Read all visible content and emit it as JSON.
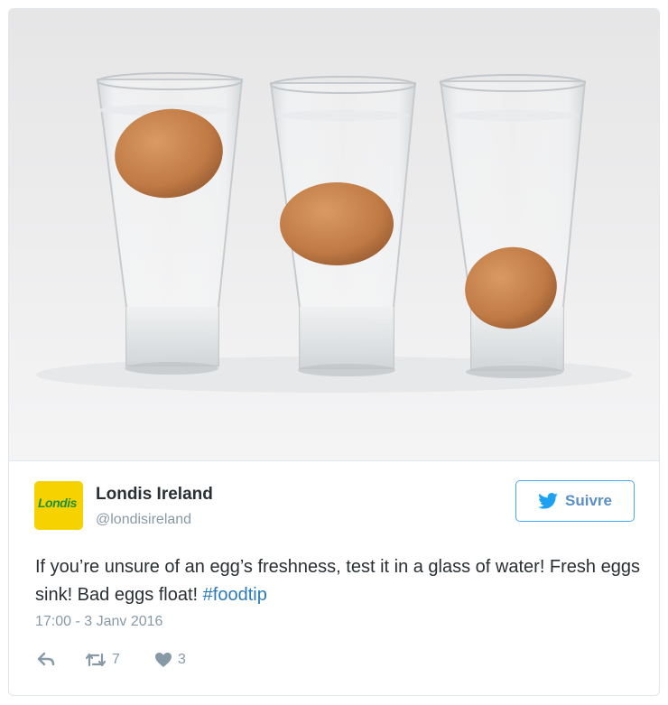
{
  "tweet": {
    "author_name": "Londis Ireland",
    "author_handle": "@londisireland",
    "avatar_text": "Londis",
    "follow_label": "Suivre",
    "text_main": "If you’re unsure of an egg’s freshness, test it in a glass of water! Fresh eggs sink! Bad eggs float! ",
    "hashtag": "#foodtip",
    "timestamp": "17:00 - 3 Janv 2016",
    "retweet_count": "7",
    "like_count": "3"
  },
  "colors": {
    "accent": "#1da1f2",
    "hashtag": "#2b7bb9",
    "avatar_bg": "#f6d200",
    "egg": "#c9824d"
  },
  "icons": [
    "twitter-bird-icon",
    "reply-icon",
    "retweet-icon",
    "heart-icon"
  ]
}
